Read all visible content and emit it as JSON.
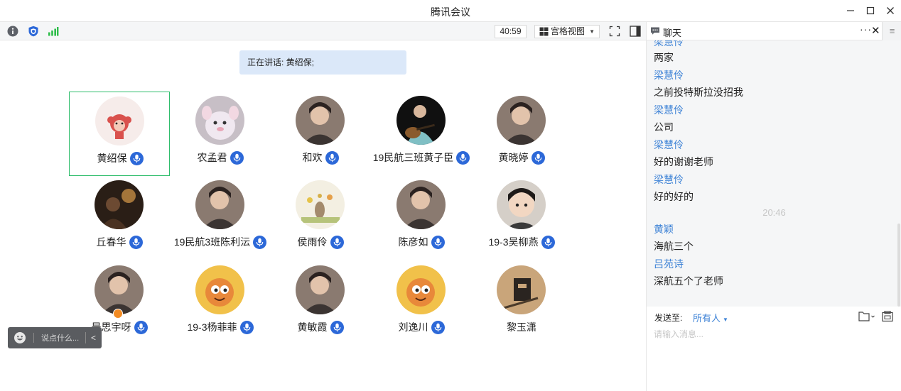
{
  "window": {
    "title": "腾讯会议"
  },
  "toolbar": {
    "timer": "40:59",
    "view_label": "宫格视图",
    "icons": [
      "info-icon",
      "shield-icon",
      "signal-icon",
      "fullscreen-icon",
      "side-panel-icon"
    ],
    "colors": {
      "signal": "#2ebd4a",
      "shield": "#2c68d8"
    }
  },
  "stage": {
    "speaking_label": "正在讲话: 黄绍保;",
    "participants": [
      {
        "name": "黄绍保",
        "mic": true,
        "active": true,
        "avatar": "monkey-cartoon"
      },
      {
        "name": "农孟君",
        "mic": true,
        "avatar": "plush-toy"
      },
      {
        "name": "和欢",
        "mic": true,
        "avatar": "person-photo"
      },
      {
        "name": "19民航三班黄子臣",
        "mic": true,
        "avatar": "guitar-photo"
      },
      {
        "name": "黄晓婷",
        "mic": true,
        "avatar": "person-photo"
      },
      {
        "name": "丘春华",
        "mic": true,
        "avatar": "dark-photo"
      },
      {
        "name": "19民航3班陈利沄",
        "mic": true,
        "avatar": "person-photo"
      },
      {
        "name": "侯雨伶",
        "mic": true,
        "avatar": "flower-drawing"
      },
      {
        "name": "陈彦如",
        "mic": true,
        "avatar": "person-photo"
      },
      {
        "name": "19-3吴柳燕",
        "mic": true,
        "avatar": "child-photo"
      },
      {
        "name": "是思宇呀",
        "mic": true,
        "host": true,
        "avatar": "person-photo"
      },
      {
        "name": "19-3杨菲菲",
        "mic": true,
        "avatar": "cartoon-character"
      },
      {
        "name": "黄敏霞",
        "mic": true,
        "avatar": "person-photo"
      },
      {
        "name": "刘逸川",
        "mic": true,
        "avatar": "cartoon-character"
      },
      {
        "name": "黎玉潇",
        "mic": false,
        "avatar": "sketch-photo"
      }
    ],
    "say_placeholder": "说点什么..."
  },
  "chat": {
    "title": "聊天",
    "more": "···",
    "close": "✕",
    "menu": "≡",
    "messages": [
      {
        "type": "sender",
        "text": "梁慧伶"
      },
      {
        "type": "text",
        "text": "两家"
      },
      {
        "type": "sender",
        "text": "梁慧伶"
      },
      {
        "type": "text",
        "text": "之前投特斯拉没招我"
      },
      {
        "type": "sender",
        "text": "梁慧伶"
      },
      {
        "type": "text",
        "text": "公司"
      },
      {
        "type": "sender",
        "text": "梁慧伶"
      },
      {
        "type": "text",
        "text": "好的谢谢老师"
      },
      {
        "type": "sender",
        "text": "梁慧伶"
      },
      {
        "type": "text",
        "text": "好的好的"
      },
      {
        "type": "time",
        "text": "20:46"
      },
      {
        "type": "sender",
        "text": "黄颖"
      },
      {
        "type": "text",
        "text": "海航三个"
      },
      {
        "type": "sender",
        "text": "吕苑诗"
      },
      {
        "type": "text",
        "text": "深航五个了老师"
      }
    ],
    "send_to_label": "发送至:",
    "send_target": "所有人",
    "input_placeholder": "请输入消息..."
  }
}
